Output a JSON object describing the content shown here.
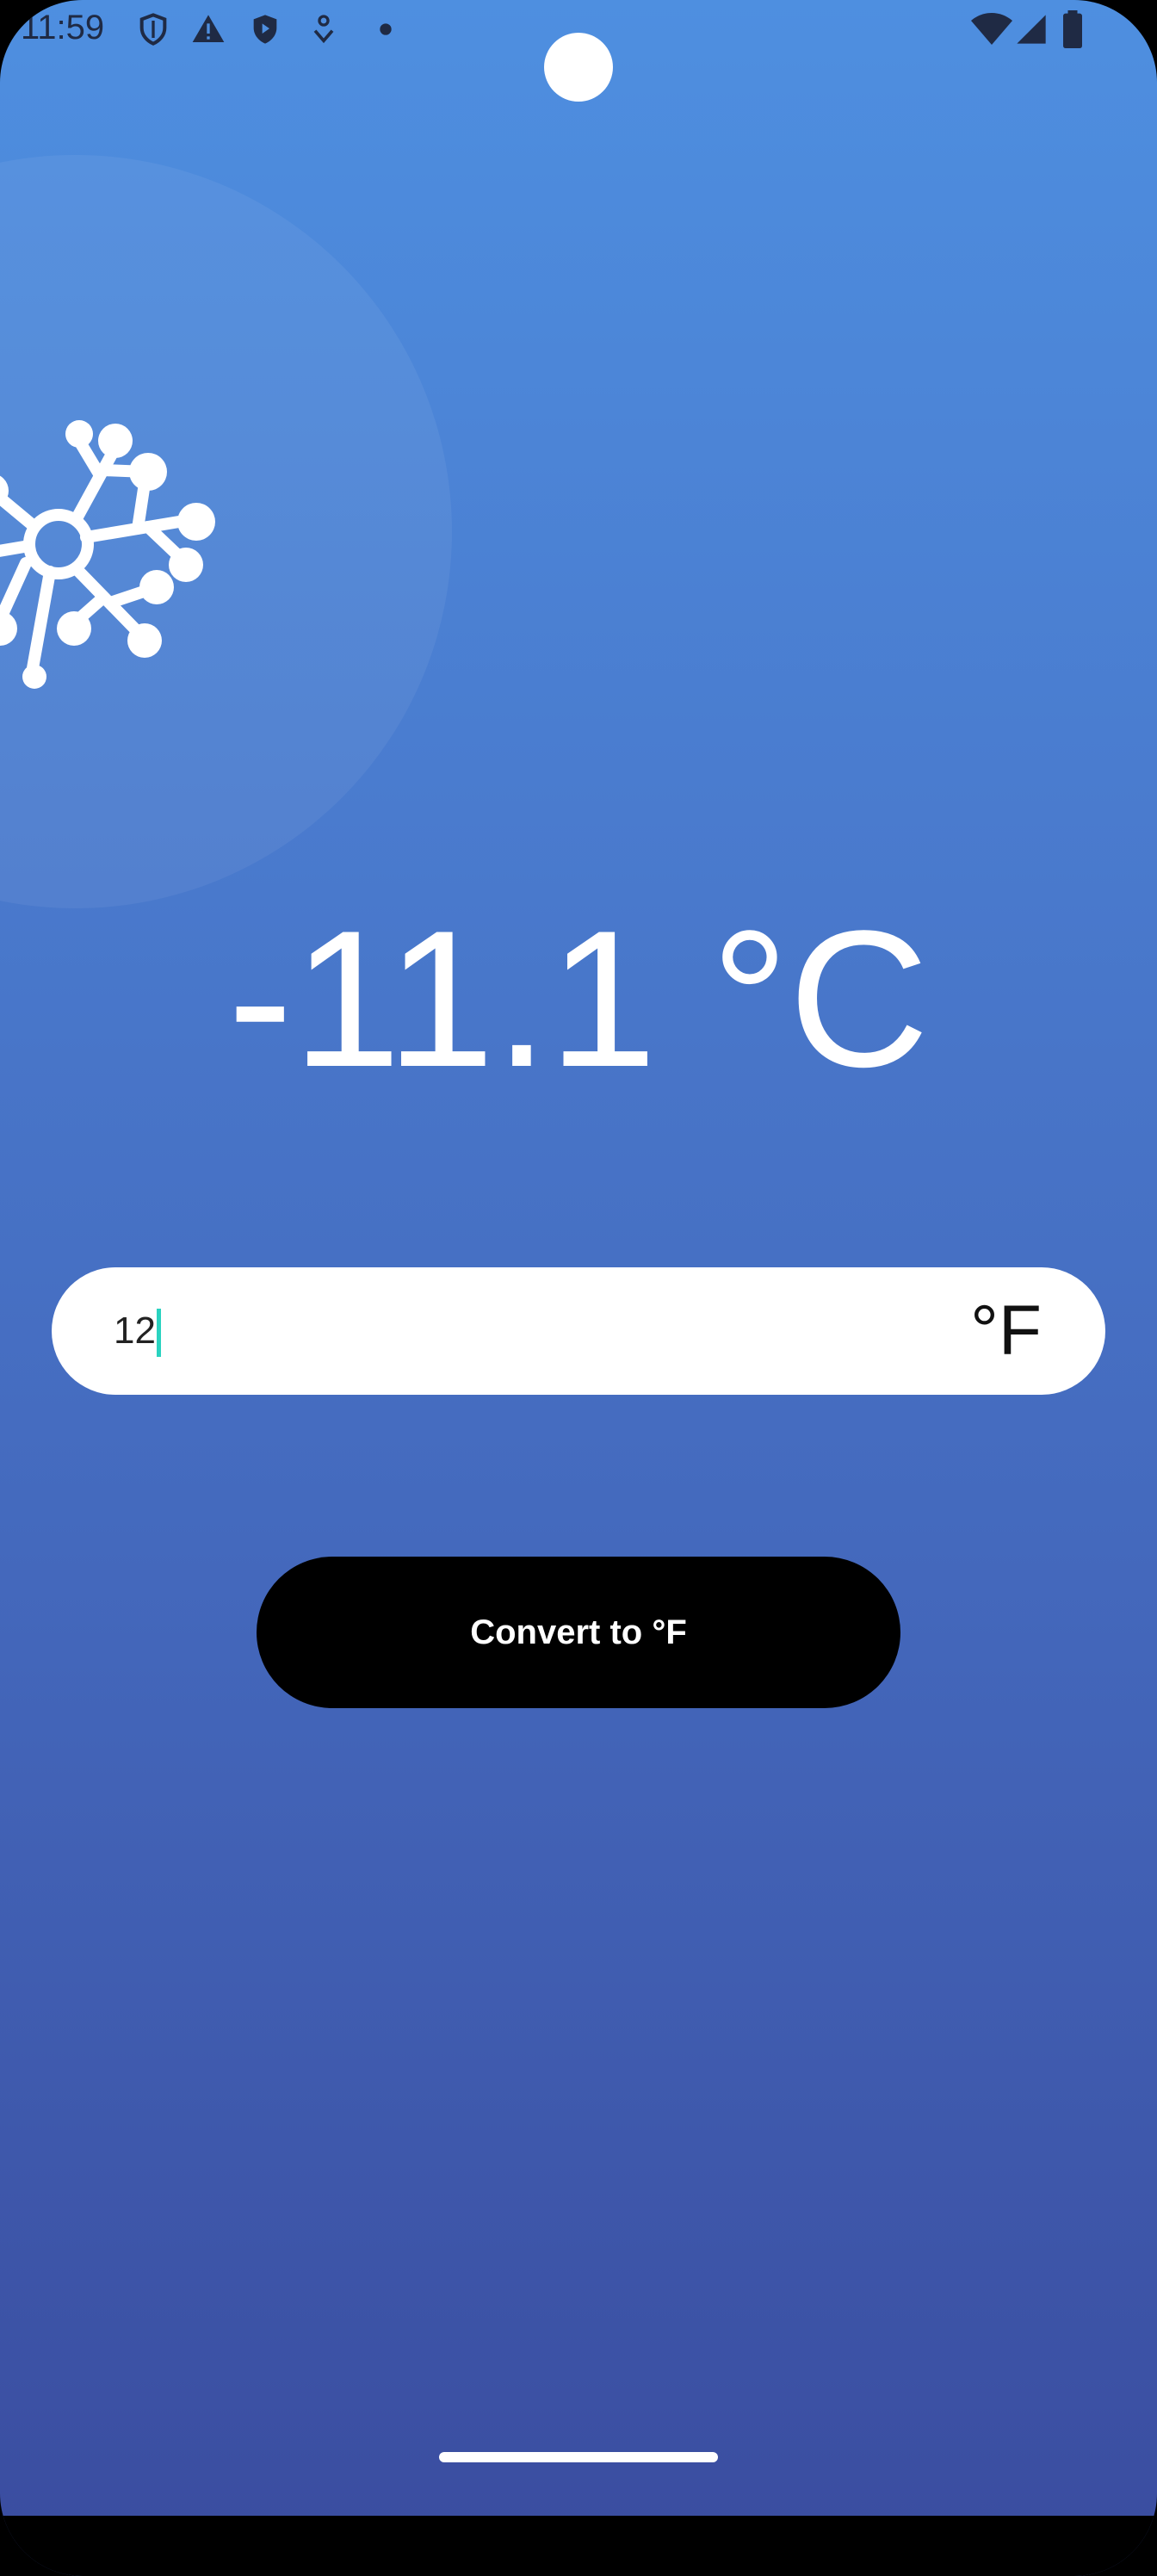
{
  "status_bar": {
    "time": "11:59",
    "left_icons": [
      "shield-icon",
      "warning-icon",
      "shield-play-icon",
      "location-heart-icon",
      "dot-icon"
    ],
    "right_icons": [
      "wifi-icon",
      "signal-icon",
      "battery-icon"
    ]
  },
  "result": {
    "value": "-11.1 °C"
  },
  "input": {
    "value": "12",
    "unit": "°F"
  },
  "button": {
    "label": "Convert to °F"
  },
  "colors": {
    "gradient_top": "#4e8fe0",
    "gradient_bottom": "#3a4c9f",
    "button_bg": "#000000",
    "caret": "#2ad3c0"
  }
}
